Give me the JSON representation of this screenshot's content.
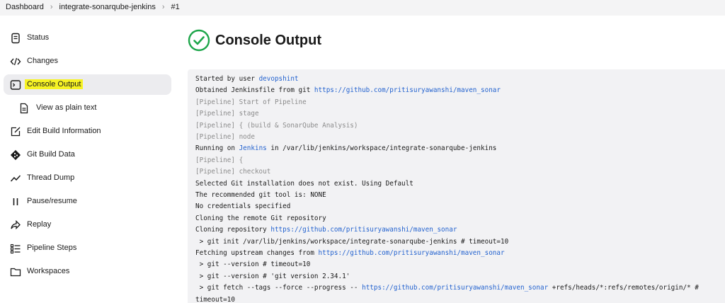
{
  "breadcrumb": {
    "items": [
      "Dashboard",
      "integrate-sonarqube-jenkins",
      "#1"
    ]
  },
  "sidebar": {
    "items": [
      {
        "label": "Status",
        "icon": "document-icon"
      },
      {
        "label": "Changes",
        "icon": "code-icon"
      },
      {
        "label": "Console Output",
        "icon": "terminal-icon",
        "active": true
      },
      {
        "label": "View as plain text",
        "icon": "file-icon",
        "sub": true
      },
      {
        "label": "Edit Build Information",
        "icon": "edit-icon"
      },
      {
        "label": "Git Build Data",
        "icon": "git-icon"
      },
      {
        "label": "Thread Dump",
        "icon": "activity-icon"
      },
      {
        "label": "Pause/resume",
        "icon": "pause-icon"
      },
      {
        "label": "Replay",
        "icon": "replay-icon"
      },
      {
        "label": "Pipeline Steps",
        "icon": "list-icon"
      },
      {
        "label": "Workspaces",
        "icon": "folder-icon"
      }
    ]
  },
  "page": {
    "title": "Console Output",
    "status_icon": "success-check-icon"
  },
  "colors": {
    "success": "#1ea64b",
    "link": "#2463cf",
    "highlight": "#f7f324",
    "console_bg": "#f2f2f4"
  },
  "console": {
    "lines": [
      {
        "t": "Started by user ",
        "link": "devopshint"
      },
      {
        "t": "Obtained Jenkinsfile from git ",
        "link": "https://github.com/pritisuryawanshi/maven_sonar"
      },
      {
        "t": "[Pipeline] Start of Pipeline",
        "dim": true
      },
      {
        "t": "[Pipeline] stage",
        "dim": true
      },
      {
        "t": "[Pipeline] { (build & SonarQube Analysis)",
        "dim": true
      },
      {
        "t": "[Pipeline] node",
        "dim": true
      },
      {
        "t": "Running on ",
        "link": "Jenkins",
        "after": " in /var/lib/jenkins/workspace/integrate-sonarqube-jenkins"
      },
      {
        "t": "[Pipeline] {",
        "dim": true
      },
      {
        "t": "[Pipeline] checkout",
        "dim": true
      },
      {
        "t": "Selected Git installation does not exist. Using Default"
      },
      {
        "t": "The recommended git tool is: NONE"
      },
      {
        "t": "No credentials specified"
      },
      {
        "t": "Cloning the remote Git repository"
      },
      {
        "t": "Cloning repository ",
        "link": "https://github.com/pritisuryawanshi/maven_sonar"
      },
      {
        "t": " > git init /var/lib/jenkins/workspace/integrate-sonarqube-jenkins # timeout=10"
      },
      {
        "t": "Fetching upstream changes from ",
        "link": "https://github.com/pritisuryawanshi/maven_sonar"
      },
      {
        "t": " > git --version # timeout=10"
      },
      {
        "t": " > git --version # 'git version 2.34.1'"
      },
      {
        "t": " > git fetch --tags --force --progress -- ",
        "link": "https://github.com/pritisuryawanshi/maven_sonar",
        "after": " +refs/heads/*:refs/remotes/origin/* #"
      },
      {
        "t": "timeout=10"
      }
    ]
  }
}
